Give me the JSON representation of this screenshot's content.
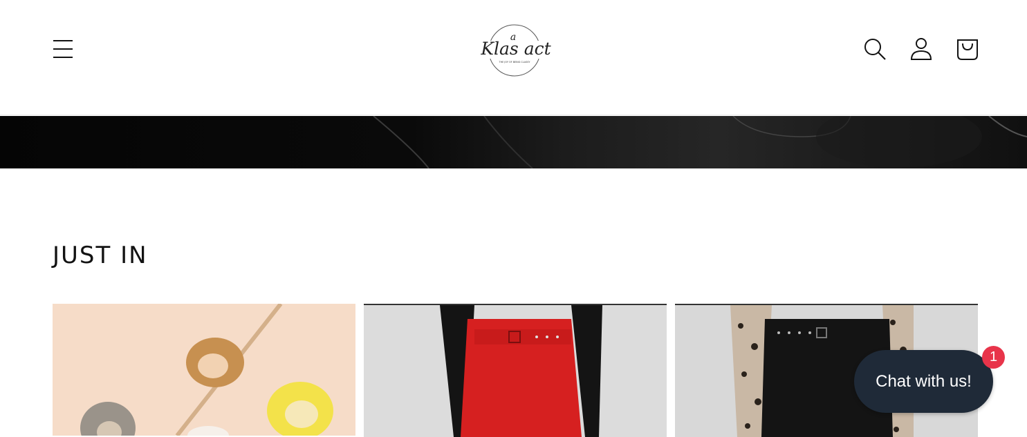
{
  "header": {
    "logo": {
      "top_letter": "a",
      "wordmark": "Klas act",
      "tagline": "THE JOY OF BEING CLASSY"
    },
    "icons": {
      "menu": "menu-icon",
      "search": "search-icon",
      "account": "account-icon",
      "cart": "cart-icon"
    }
  },
  "section": {
    "title": "JUST IN"
  },
  "products": [
    {
      "image": "resin-rings-image"
    },
    {
      "image": "red-belted-trousers-image"
    },
    {
      "image": "black-belted-trousers-leopard-top-image"
    }
  ],
  "chat": {
    "label": "Chat with us!",
    "badge_count": "1"
  },
  "colors": {
    "chat_bg": "#1f2a38",
    "badge_bg": "#e8344a",
    "text": "#121212"
  }
}
